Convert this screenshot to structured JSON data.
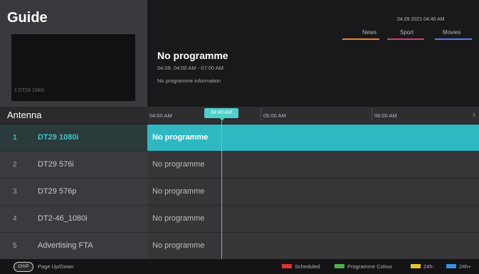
{
  "guide": {
    "title": "Guide"
  },
  "preview": {
    "label": "1 DT29 1080i"
  },
  "info": {
    "date_time": "04.09.2021 04:40 AM",
    "categories": [
      {
        "label": "News",
        "color": "#e8833a"
      },
      {
        "label": "Sport",
        "color": "#d23a7a"
      },
      {
        "label": "Movies",
        "color": "#5a7ee8"
      }
    ],
    "programme_title": "No programme",
    "programme_time": "04.09. 04:00 AM - 07:00 AM",
    "programme_info": "No programme information"
  },
  "channel_list": {
    "header": "Antenna",
    "channels": [
      {
        "num": "1",
        "name": "DT29 1080i",
        "selected": true
      },
      {
        "num": "2",
        "name": "DT29 576i"
      },
      {
        "num": "3",
        "name": "DT29 576p"
      },
      {
        "num": "4",
        "name": "DT2-46_1080i"
      },
      {
        "num": "5",
        "name": "Advertising FTA"
      }
    ]
  },
  "timeline": {
    "times": [
      "04:00 AM",
      "05:00 AM",
      "06:00 AM"
    ],
    "current_time": "04:40 AM"
  },
  "programmes": [
    "No programme",
    "No programme",
    "No programme",
    "No programme",
    "No programme"
  ],
  "footer": {
    "button_label": "CH/P",
    "page_label": "Page Up/Down",
    "legend": [
      {
        "label": "Scheduled",
        "color": "#e03030"
      },
      {
        "label": "Programme Colour",
        "color": "#4cae4c"
      },
      {
        "label": "24h-",
        "color": "#e8c22a"
      },
      {
        "label": "24h+",
        "color": "#3a8ee0"
      }
    ]
  }
}
